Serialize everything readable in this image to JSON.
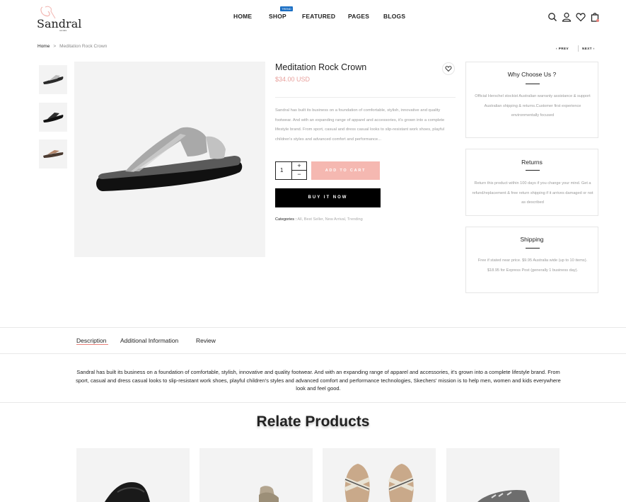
{
  "header": {
    "logo_text": "Sandral",
    "logo_tagline": "sandals",
    "nav": [
      {
        "label": "HOME"
      },
      {
        "label": "SHOP",
        "badge": "TREND"
      },
      {
        "label": "FEATURED"
      },
      {
        "label": "PAGES"
      },
      {
        "label": "BLOGS"
      }
    ],
    "icons": [
      "search-icon",
      "user-icon",
      "heart-icon",
      "cart-icon"
    ],
    "badge_color": "#1b6fc4"
  },
  "breadcrumb": {
    "home": "Home",
    "separator": ">",
    "current": "Meditation Rock Crown"
  },
  "pager": {
    "prev": "PREV",
    "next": "NEXT"
  },
  "product": {
    "title": "Meditation Rock Crown",
    "price": "$34.00 USD",
    "description": "Sandral has built its business on a foundation of comfortable, stylish, innovative and quality footwear. And with an expanding range of apparel and accessories, it's grown into a complete lifestyle brand. From sport, casual and dress casual looks to slip-resistant work shoes, playful children's styles and advanced comfort and performance...",
    "quantity": "1",
    "plus": "+",
    "minus": "−",
    "add_to_cart": "ADD TO CART",
    "buy_now": "BUY IT NOW",
    "categories_label": "Categories :",
    "categories": "All, Best Seller, New Arrival, Trending",
    "price_color": "#e8a09c",
    "add_to_cart_color": "#f5b8b1"
  },
  "side_boxes": [
    {
      "title": "Why Choose Us ?",
      "text": "Official Herschel stockist Australian warranty assistance & support Australian shipping & returns.Customer first experience environmentally focused"
    },
    {
      "title": "Returns",
      "text": "Return this product within 100 days if you change your mind. Get a refund/replacement & free return shipping if it arrives damaged or not as described"
    },
    {
      "title": "Shipping",
      "text": "Free if stated near price. $9.95 Australia wide (up to 10 items). $18.95 for Express Post (generally 1 business day)."
    }
  ],
  "tabs": [
    {
      "label": "Description",
      "active": true
    },
    {
      "label": "Additional Information",
      "active": false
    },
    {
      "label": "Review",
      "active": false
    }
  ],
  "description_full": "Sandral has built its business on a foundation of comfortable, stylish, innovative and quality footwear. And with an expanding range of apparel and accessories, it's grown into a complete lifestyle brand. From sport, casual and dress casual looks to slip-resistant work shoes, playful children's styles and advanced comfort and performance technologies, Skechers' mission is to help men, women and kids everywhere look and feel good.",
  "related": {
    "title": "Relate Products",
    "items": [
      "black-slide-sandal",
      "taupe-strap-sandal",
      "striped-cross-sandal",
      "grey-slide-sandal"
    ]
  }
}
